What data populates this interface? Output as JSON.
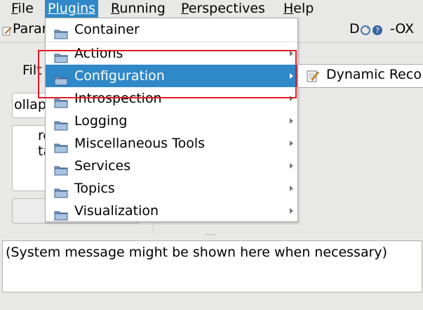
{
  "menubar": {
    "file": "File",
    "plugins": "Plugins",
    "running": "Running",
    "perspectives": "Perspectives",
    "help": "Help"
  },
  "plugin_bar": {
    "tab_label": "Parar",
    "right_label": "D",
    "right_suffix": "-OX"
  },
  "background": {
    "filter_label": "Filt",
    "collapse_label": "ollap",
    "text_line1": "re",
    "text_line2": "ta"
  },
  "plugins_menu": {
    "items": [
      {
        "label": "Container",
        "has_submenu": false,
        "icon": "folder-icon"
      },
      {
        "label": "Actions",
        "has_submenu": true,
        "icon": "folder-icon"
      },
      {
        "label": "Configuration",
        "has_submenu": true,
        "icon": "folder-icon",
        "selected": true
      },
      {
        "label": "Introspection",
        "has_submenu": true,
        "icon": "folder-icon"
      },
      {
        "label": "Logging",
        "has_submenu": true,
        "icon": "folder-icon"
      },
      {
        "label": "Miscellaneous Tools",
        "has_submenu": true,
        "icon": "folder-icon"
      },
      {
        "label": "Services",
        "has_submenu": true,
        "icon": "folder-icon"
      },
      {
        "label": "Topics",
        "has_submenu": true,
        "icon": "folder-icon"
      },
      {
        "label": "Visualization",
        "has_submenu": true,
        "icon": "folder-icon"
      }
    ]
  },
  "submenu": {
    "items": [
      {
        "label": "Dynamic Reco",
        "icon": "edit-document-icon"
      }
    ]
  },
  "status": {
    "message": "(System message might be shown here when necessary)"
  },
  "colors": {
    "selection": "#2f88c8",
    "highlight_box": "#e01b24",
    "background": "#e8e8e7"
  }
}
